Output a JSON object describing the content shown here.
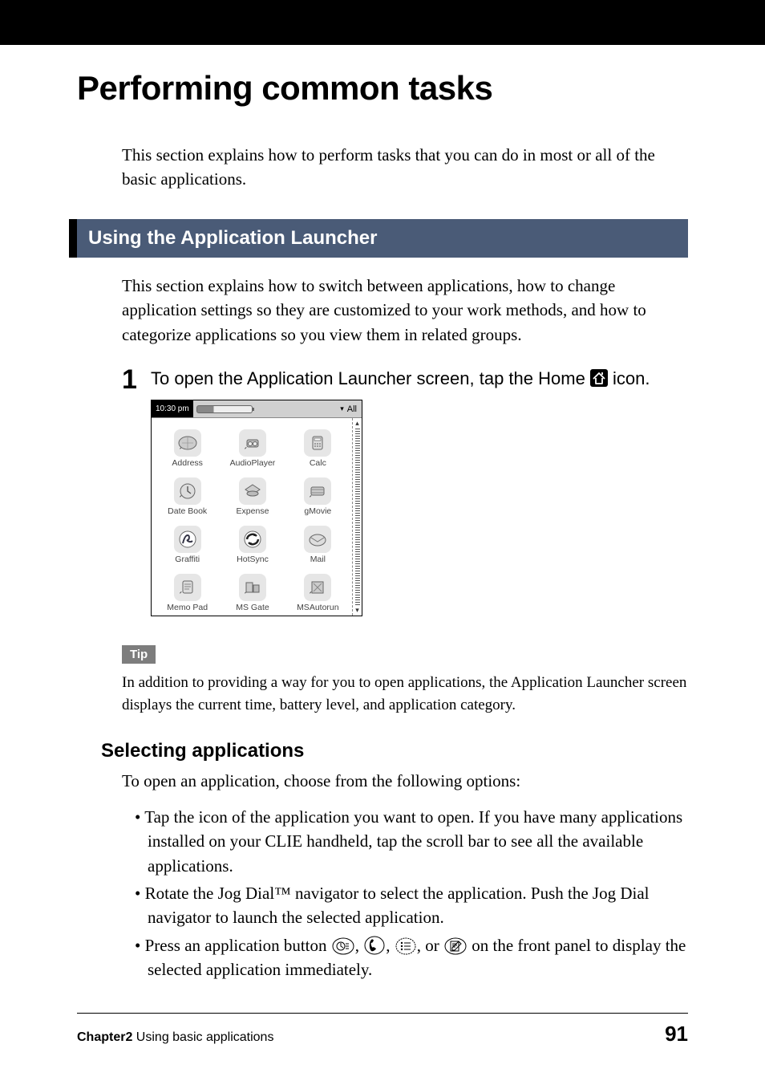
{
  "page_title": "Performing common tasks",
  "intro": "This section explains how to perform tasks that you can do in most or all of the basic applications.",
  "section_heading": "Using the Application Launcher",
  "section_intro": "This section explains how to switch between applications, how to change application settings so they are customized to your work methods, and how to categorize applications so you view them in related groups.",
  "step1": {
    "num": "1",
    "text_before_icon": "To open the Application Launcher screen, tap the Home ",
    "text_after_icon": " icon."
  },
  "screenshot": {
    "time": "10:30 pm",
    "category": "All",
    "apps": [
      {
        "label": "Address",
        "icon": "address"
      },
      {
        "label": "AudioPlayer",
        "icon": "audio"
      },
      {
        "label": "Calc",
        "icon": "calc"
      },
      {
        "label": "Date Book",
        "icon": "datebook"
      },
      {
        "label": "Expense",
        "icon": "expense"
      },
      {
        "label": "gMovie",
        "icon": "gmovie"
      },
      {
        "label": "Graffiti",
        "icon": "graffiti"
      },
      {
        "label": "HotSync",
        "icon": "hotsync"
      },
      {
        "label": "Mail",
        "icon": "mail"
      },
      {
        "label": "Memo Pad",
        "icon": "memopad"
      },
      {
        "label": "MS Gate",
        "icon": "msgate"
      },
      {
        "label": "MSAutorun",
        "icon": "msautorun"
      }
    ]
  },
  "tip_label": "Tip",
  "tip_text": "In addition to providing a way for you to open applications, the Application Launcher screen displays the current time, battery level, and application category.",
  "selecting_heading": "Selecting applications",
  "selecting_intro": "To open an application, choose from the following options:",
  "bullets": {
    "b1": "Tap the icon of the application you want to open. If you have many applications installed on your CLIE handheld, tap the scroll bar to see all the available applications.",
    "b2": "Rotate the Jog Dial™ navigator to select the application. Push the Jog Dial navigator to launch the selected application.",
    "b3_pre": "Press an application button ",
    "b3_mid1": ", ",
    "b3_mid2": ", ",
    "b3_mid3": ", or ",
    "b3_post": " on the front panel to display the selected application immediately."
  },
  "footer": {
    "chapter_bold": "Chapter2",
    "chapter_rest": "   Using basic applications",
    "page_num": "91"
  }
}
